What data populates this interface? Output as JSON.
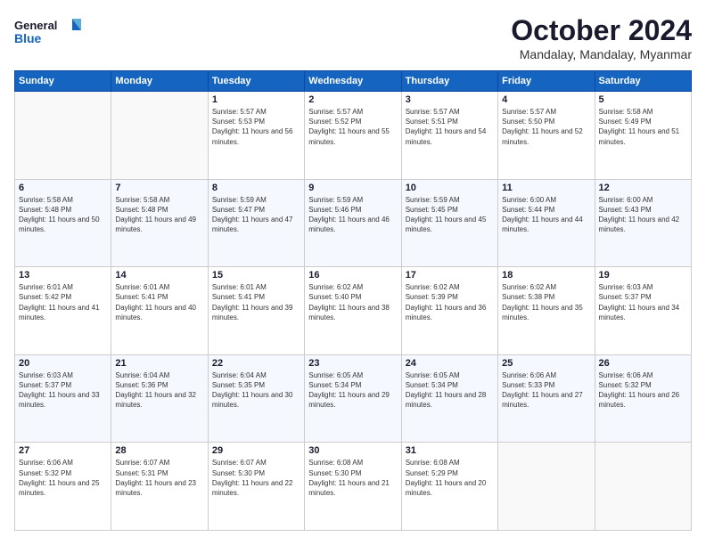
{
  "logo": {
    "line1": "General",
    "line2": "Blue"
  },
  "title": "October 2024",
  "location": "Mandalay, Mandalay, Myanmar",
  "days_of_week": [
    "Sunday",
    "Monday",
    "Tuesday",
    "Wednesday",
    "Thursday",
    "Friday",
    "Saturday"
  ],
  "weeks": [
    [
      {
        "day": "",
        "info": ""
      },
      {
        "day": "",
        "info": ""
      },
      {
        "day": "1",
        "info": "Sunrise: 5:57 AM\nSunset: 5:53 PM\nDaylight: 11 hours and 56 minutes."
      },
      {
        "day": "2",
        "info": "Sunrise: 5:57 AM\nSunset: 5:52 PM\nDaylight: 11 hours and 55 minutes."
      },
      {
        "day": "3",
        "info": "Sunrise: 5:57 AM\nSunset: 5:51 PM\nDaylight: 11 hours and 54 minutes."
      },
      {
        "day": "4",
        "info": "Sunrise: 5:57 AM\nSunset: 5:50 PM\nDaylight: 11 hours and 52 minutes."
      },
      {
        "day": "5",
        "info": "Sunrise: 5:58 AM\nSunset: 5:49 PM\nDaylight: 11 hours and 51 minutes."
      }
    ],
    [
      {
        "day": "6",
        "info": "Sunrise: 5:58 AM\nSunset: 5:48 PM\nDaylight: 11 hours and 50 minutes."
      },
      {
        "day": "7",
        "info": "Sunrise: 5:58 AM\nSunset: 5:48 PM\nDaylight: 11 hours and 49 minutes."
      },
      {
        "day": "8",
        "info": "Sunrise: 5:59 AM\nSunset: 5:47 PM\nDaylight: 11 hours and 47 minutes."
      },
      {
        "day": "9",
        "info": "Sunrise: 5:59 AM\nSunset: 5:46 PM\nDaylight: 11 hours and 46 minutes."
      },
      {
        "day": "10",
        "info": "Sunrise: 5:59 AM\nSunset: 5:45 PM\nDaylight: 11 hours and 45 minutes."
      },
      {
        "day": "11",
        "info": "Sunrise: 6:00 AM\nSunset: 5:44 PM\nDaylight: 11 hours and 44 minutes."
      },
      {
        "day": "12",
        "info": "Sunrise: 6:00 AM\nSunset: 5:43 PM\nDaylight: 11 hours and 42 minutes."
      }
    ],
    [
      {
        "day": "13",
        "info": "Sunrise: 6:01 AM\nSunset: 5:42 PM\nDaylight: 11 hours and 41 minutes."
      },
      {
        "day": "14",
        "info": "Sunrise: 6:01 AM\nSunset: 5:41 PM\nDaylight: 11 hours and 40 minutes."
      },
      {
        "day": "15",
        "info": "Sunrise: 6:01 AM\nSunset: 5:41 PM\nDaylight: 11 hours and 39 minutes."
      },
      {
        "day": "16",
        "info": "Sunrise: 6:02 AM\nSunset: 5:40 PM\nDaylight: 11 hours and 38 minutes."
      },
      {
        "day": "17",
        "info": "Sunrise: 6:02 AM\nSunset: 5:39 PM\nDaylight: 11 hours and 36 minutes."
      },
      {
        "day": "18",
        "info": "Sunrise: 6:02 AM\nSunset: 5:38 PM\nDaylight: 11 hours and 35 minutes."
      },
      {
        "day": "19",
        "info": "Sunrise: 6:03 AM\nSunset: 5:37 PM\nDaylight: 11 hours and 34 minutes."
      }
    ],
    [
      {
        "day": "20",
        "info": "Sunrise: 6:03 AM\nSunset: 5:37 PM\nDaylight: 11 hours and 33 minutes."
      },
      {
        "day": "21",
        "info": "Sunrise: 6:04 AM\nSunset: 5:36 PM\nDaylight: 11 hours and 32 minutes."
      },
      {
        "day": "22",
        "info": "Sunrise: 6:04 AM\nSunset: 5:35 PM\nDaylight: 11 hours and 30 minutes."
      },
      {
        "day": "23",
        "info": "Sunrise: 6:05 AM\nSunset: 5:34 PM\nDaylight: 11 hours and 29 minutes."
      },
      {
        "day": "24",
        "info": "Sunrise: 6:05 AM\nSunset: 5:34 PM\nDaylight: 11 hours and 28 minutes."
      },
      {
        "day": "25",
        "info": "Sunrise: 6:06 AM\nSunset: 5:33 PM\nDaylight: 11 hours and 27 minutes."
      },
      {
        "day": "26",
        "info": "Sunrise: 6:06 AM\nSunset: 5:32 PM\nDaylight: 11 hours and 26 minutes."
      }
    ],
    [
      {
        "day": "27",
        "info": "Sunrise: 6:06 AM\nSunset: 5:32 PM\nDaylight: 11 hours and 25 minutes."
      },
      {
        "day": "28",
        "info": "Sunrise: 6:07 AM\nSunset: 5:31 PM\nDaylight: 11 hours and 23 minutes."
      },
      {
        "day": "29",
        "info": "Sunrise: 6:07 AM\nSunset: 5:30 PM\nDaylight: 11 hours and 22 minutes."
      },
      {
        "day": "30",
        "info": "Sunrise: 6:08 AM\nSunset: 5:30 PM\nDaylight: 11 hours and 21 minutes."
      },
      {
        "day": "31",
        "info": "Sunrise: 6:08 AM\nSunset: 5:29 PM\nDaylight: 11 hours and 20 minutes."
      },
      {
        "day": "",
        "info": ""
      },
      {
        "day": "",
        "info": ""
      }
    ]
  ]
}
